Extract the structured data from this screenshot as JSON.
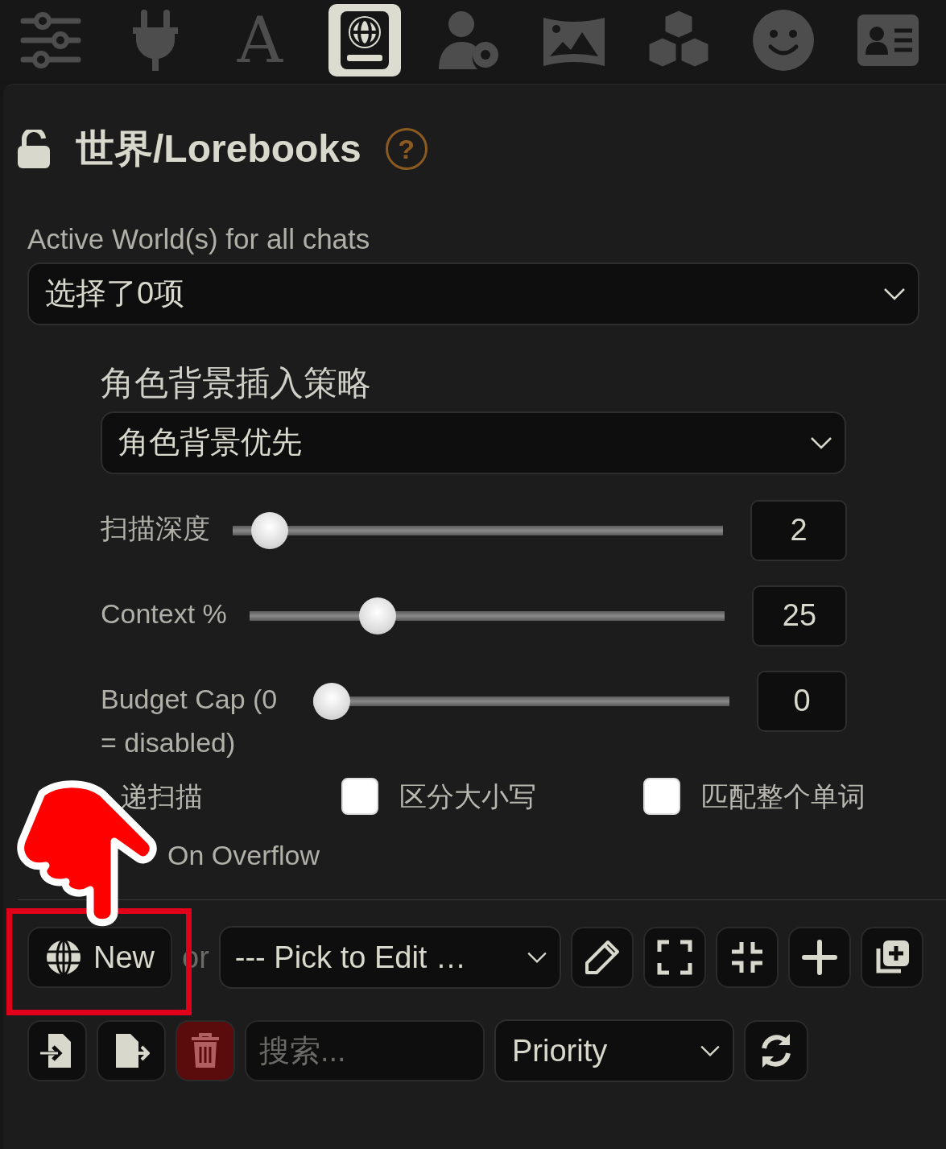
{
  "nav": [
    {
      "selected": false
    },
    {
      "selected": false
    },
    {
      "glyph": "A",
      "selected": false
    },
    {
      "selected": true
    },
    {
      "selected": false
    },
    {
      "selected": false
    },
    {
      "selected": false
    },
    {
      "selected": false
    },
    {
      "selected": false
    }
  ],
  "title": "世界/Lorebooks",
  "help": "?",
  "active_worlds": {
    "label": "Active World(s) for all chats",
    "value": "选择了0项"
  },
  "strategy": {
    "label": "角色背景插入策略",
    "value": "角色背景优先"
  },
  "sliders": [
    {
      "label": "扫描深度",
      "level": 0.04,
      "value": "2"
    },
    {
      "label": "Context %",
      "level": 0.25,
      "value": "25"
    },
    {
      "label": "Budget Cap (0 = disabled)",
      "level": 0,
      "value": "0"
    }
  ],
  "partial_label": "递扫描",
  "checkboxes": [
    {
      "label": "区分大小写",
      "checked": false
    },
    {
      "label": "匹配整个单词",
      "checked": false
    }
  ],
  "overflow_label": "On Overflow",
  "new_button": "New",
  "or_text": "or",
  "pick_select": "--- Pick to Edit …",
  "search": {
    "placeholder": "搜索..."
  },
  "sort": "Priority"
}
